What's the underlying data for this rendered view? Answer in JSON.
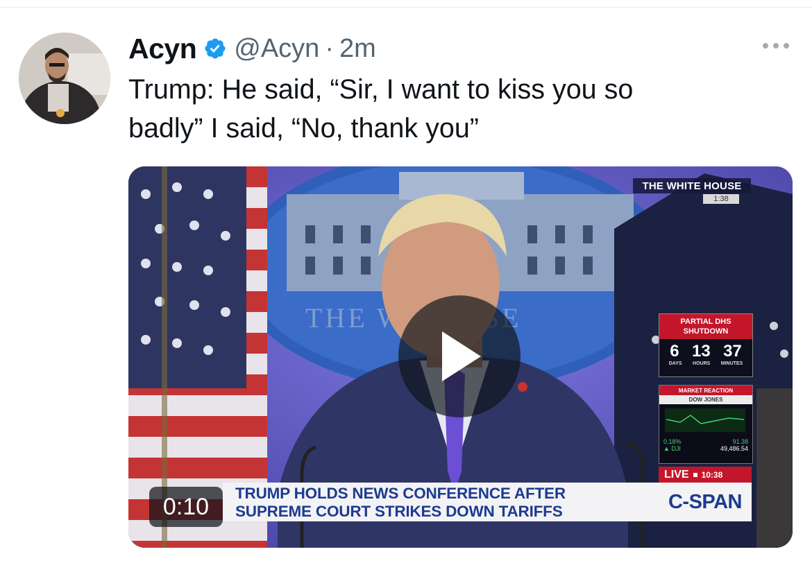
{
  "tweet": {
    "display_name": "Acyn",
    "handle": "@Acyn",
    "separator": "·",
    "time": "2m",
    "text_line1": "Trump: He said, “Sir, I want to kiss you so",
    "text_line2": "badly” I said, “No, thank you”"
  },
  "video": {
    "duration": "0:10",
    "network_tag": "THE WHITE HOUSE",
    "network_time": "1:38",
    "backdrop_text": "THE W      HOUSE",
    "shutdown_title_line1": "PARTIAL DHS",
    "shutdown_title_line2": "SHUTDOWN",
    "countdown": {
      "days": "6",
      "hours": "13",
      "minutes": "37"
    },
    "countdown_units": {
      "days": "DAYS",
      "hours": "HOURS",
      "minutes": "MINUTES"
    },
    "market_title": "MARKET REACTION",
    "market_sub": "DOW JONES",
    "market_change": "0.18%",
    "market_points": "91.38",
    "market_index": "▲ DJI",
    "market_value": "49,486.54",
    "live_label": "LIVE",
    "live_time": "10:38",
    "chyron_line1": "TRUMP HOLDS NEWS CONFERENCE AFTER",
    "chyron_line2": "SUPREME COURT STRIKES DOWN TARIFFS",
    "network_logo": "C-SPAN"
  },
  "colors": {
    "verified_blue": "#1d9bf0",
    "cspan_blue": "#1d3b8f",
    "cspan_red": "#c4162a",
    "text": "#0f1419",
    "muted": "#536471"
  },
  "icons": {
    "verified": "verified-badge-icon",
    "more": "more-horizontal-icon",
    "play": "play-icon"
  }
}
